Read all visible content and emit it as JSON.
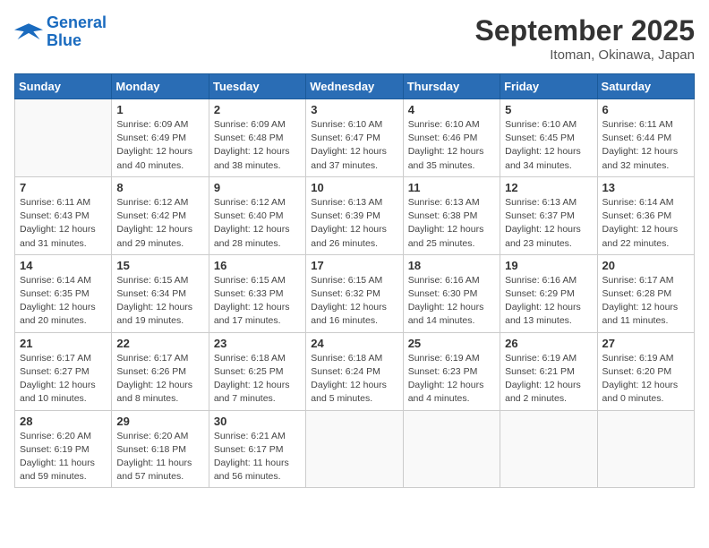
{
  "header": {
    "logo_line1": "General",
    "logo_line2": "Blue",
    "month": "September 2025",
    "location": "Itoman, Okinawa, Japan"
  },
  "weekdays": [
    "Sunday",
    "Monday",
    "Tuesday",
    "Wednesday",
    "Thursday",
    "Friday",
    "Saturday"
  ],
  "weeks": [
    [
      {
        "day": "",
        "info": ""
      },
      {
        "day": "1",
        "info": "Sunrise: 6:09 AM\nSunset: 6:49 PM\nDaylight: 12 hours\nand 40 minutes."
      },
      {
        "day": "2",
        "info": "Sunrise: 6:09 AM\nSunset: 6:48 PM\nDaylight: 12 hours\nand 38 minutes."
      },
      {
        "day": "3",
        "info": "Sunrise: 6:10 AM\nSunset: 6:47 PM\nDaylight: 12 hours\nand 37 minutes."
      },
      {
        "day": "4",
        "info": "Sunrise: 6:10 AM\nSunset: 6:46 PM\nDaylight: 12 hours\nand 35 minutes."
      },
      {
        "day": "5",
        "info": "Sunrise: 6:10 AM\nSunset: 6:45 PM\nDaylight: 12 hours\nand 34 minutes."
      },
      {
        "day": "6",
        "info": "Sunrise: 6:11 AM\nSunset: 6:44 PM\nDaylight: 12 hours\nand 32 minutes."
      }
    ],
    [
      {
        "day": "7",
        "info": "Sunrise: 6:11 AM\nSunset: 6:43 PM\nDaylight: 12 hours\nand 31 minutes."
      },
      {
        "day": "8",
        "info": "Sunrise: 6:12 AM\nSunset: 6:42 PM\nDaylight: 12 hours\nand 29 minutes."
      },
      {
        "day": "9",
        "info": "Sunrise: 6:12 AM\nSunset: 6:40 PM\nDaylight: 12 hours\nand 28 minutes."
      },
      {
        "day": "10",
        "info": "Sunrise: 6:13 AM\nSunset: 6:39 PM\nDaylight: 12 hours\nand 26 minutes."
      },
      {
        "day": "11",
        "info": "Sunrise: 6:13 AM\nSunset: 6:38 PM\nDaylight: 12 hours\nand 25 minutes."
      },
      {
        "day": "12",
        "info": "Sunrise: 6:13 AM\nSunset: 6:37 PM\nDaylight: 12 hours\nand 23 minutes."
      },
      {
        "day": "13",
        "info": "Sunrise: 6:14 AM\nSunset: 6:36 PM\nDaylight: 12 hours\nand 22 minutes."
      }
    ],
    [
      {
        "day": "14",
        "info": "Sunrise: 6:14 AM\nSunset: 6:35 PM\nDaylight: 12 hours\nand 20 minutes."
      },
      {
        "day": "15",
        "info": "Sunrise: 6:15 AM\nSunset: 6:34 PM\nDaylight: 12 hours\nand 19 minutes."
      },
      {
        "day": "16",
        "info": "Sunrise: 6:15 AM\nSunset: 6:33 PM\nDaylight: 12 hours\nand 17 minutes."
      },
      {
        "day": "17",
        "info": "Sunrise: 6:15 AM\nSunset: 6:32 PM\nDaylight: 12 hours\nand 16 minutes."
      },
      {
        "day": "18",
        "info": "Sunrise: 6:16 AM\nSunset: 6:30 PM\nDaylight: 12 hours\nand 14 minutes."
      },
      {
        "day": "19",
        "info": "Sunrise: 6:16 AM\nSunset: 6:29 PM\nDaylight: 12 hours\nand 13 minutes."
      },
      {
        "day": "20",
        "info": "Sunrise: 6:17 AM\nSunset: 6:28 PM\nDaylight: 12 hours\nand 11 minutes."
      }
    ],
    [
      {
        "day": "21",
        "info": "Sunrise: 6:17 AM\nSunset: 6:27 PM\nDaylight: 12 hours\nand 10 minutes."
      },
      {
        "day": "22",
        "info": "Sunrise: 6:17 AM\nSunset: 6:26 PM\nDaylight: 12 hours\nand 8 minutes."
      },
      {
        "day": "23",
        "info": "Sunrise: 6:18 AM\nSunset: 6:25 PM\nDaylight: 12 hours\nand 7 minutes."
      },
      {
        "day": "24",
        "info": "Sunrise: 6:18 AM\nSunset: 6:24 PM\nDaylight: 12 hours\nand 5 minutes."
      },
      {
        "day": "25",
        "info": "Sunrise: 6:19 AM\nSunset: 6:23 PM\nDaylight: 12 hours\nand 4 minutes."
      },
      {
        "day": "26",
        "info": "Sunrise: 6:19 AM\nSunset: 6:21 PM\nDaylight: 12 hours\nand 2 minutes."
      },
      {
        "day": "27",
        "info": "Sunrise: 6:19 AM\nSunset: 6:20 PM\nDaylight: 12 hours\nand 0 minutes."
      }
    ],
    [
      {
        "day": "28",
        "info": "Sunrise: 6:20 AM\nSunset: 6:19 PM\nDaylight: 11 hours\nand 59 minutes."
      },
      {
        "day": "29",
        "info": "Sunrise: 6:20 AM\nSunset: 6:18 PM\nDaylight: 11 hours\nand 57 minutes."
      },
      {
        "day": "30",
        "info": "Sunrise: 6:21 AM\nSunset: 6:17 PM\nDaylight: 11 hours\nand 56 minutes."
      },
      {
        "day": "",
        "info": ""
      },
      {
        "day": "",
        "info": ""
      },
      {
        "day": "",
        "info": ""
      },
      {
        "day": "",
        "info": ""
      }
    ]
  ]
}
